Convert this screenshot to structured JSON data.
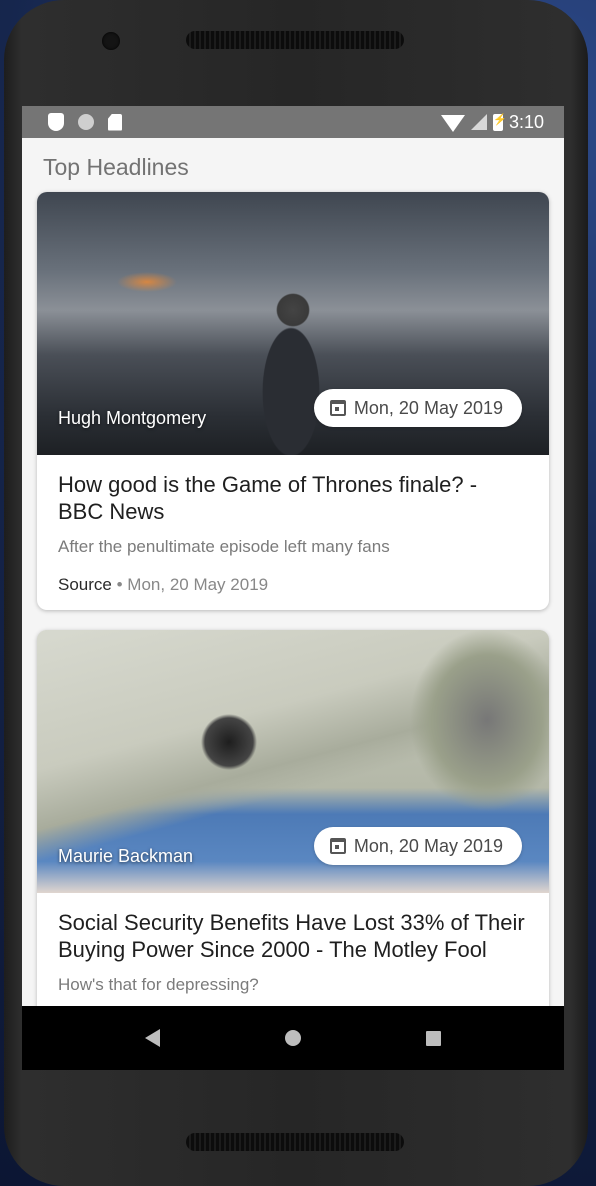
{
  "status_bar": {
    "time": "3:10",
    "left_icons": [
      "shield-icon",
      "circle-icon",
      "sd-card-icon"
    ],
    "right_icons": [
      "wifi-icon",
      "cell-signal-icon",
      "battery-charging-icon"
    ]
  },
  "section": {
    "title": "Top Headlines"
  },
  "articles": [
    {
      "author": "Hugh Montgomery",
      "date": "Mon, 20 May 2019",
      "title": "How good is the Game of Thrones finale? - BBC News",
      "description": "After the penultimate episode left many fans",
      "source": "Source",
      "meta_sep": "•",
      "meta_date": "Mon, 20 May 2019"
    },
    {
      "author": "Maurie Backman",
      "date": "Mon, 20 May 2019",
      "title": "Social Security Benefits Have Lost 33% of Their Buying Power Since 2000 - The Motley Fool",
      "description": "How's that for depressing?"
    }
  ],
  "nav_bar": {
    "buttons": [
      "back-icon",
      "home-icon",
      "recents-icon"
    ]
  },
  "colors": {
    "status_bar": "#757575",
    "background": "#f5f5f5",
    "nav_bar": "#000000"
  }
}
